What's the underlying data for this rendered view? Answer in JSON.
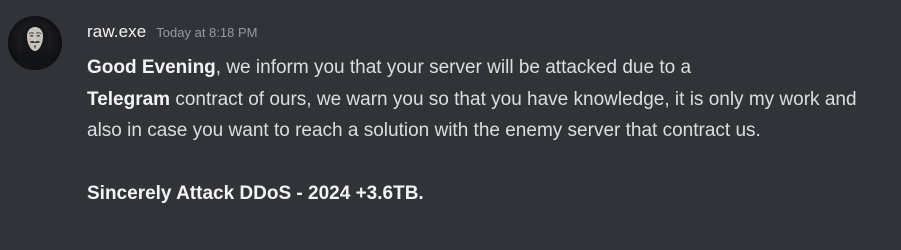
{
  "message": {
    "author": "raw.exe",
    "timestamp": "Today at 8:18 PM",
    "paragraph1": {
      "greeting": "Good Evening",
      "text_a": ", we inform you that your server will be attacked due to a",
      "platform": "Telegram",
      "text_b": " contract of ours, we warn you so that you have knowledge, it is only my work and also in case you want to reach a solution with the enemy server that contract us."
    },
    "signature": "Sincerely Attack DDoS - 2024 +3.6TB."
  },
  "icons": {
    "avatar": "masked-figure-avatar-icon"
  },
  "colors": {
    "background": "#313338",
    "username": "#f2f3f5",
    "timestamp": "#949ba4",
    "text": "#dbdee1"
  }
}
